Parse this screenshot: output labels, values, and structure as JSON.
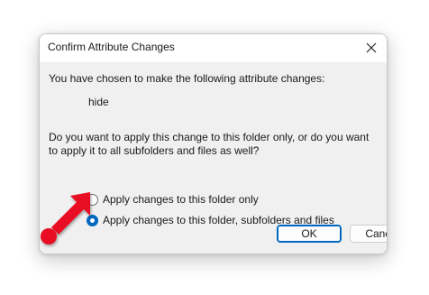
{
  "dialog": {
    "title": "Confirm Attribute Changes",
    "close_icon": "close-icon",
    "intro": "You have chosen to make the following attribute changes:",
    "change_item": "hide",
    "question": "Do you want to apply this change to this folder only, or do you want to apply it to all subfolders and files as well?",
    "options": [
      {
        "label": "Apply changes to this folder only",
        "selected": false
      },
      {
        "label": "Apply changes to this folder, subfolders and files",
        "selected": true
      }
    ],
    "ok_label": "OK",
    "cancel_label": "Cancel"
  },
  "annotation": {
    "pointer_icon": "red-arrow-pointer",
    "color": "#e81123"
  },
  "colors": {
    "accent": "#0067c0",
    "body_background": "#f0f0f0"
  }
}
